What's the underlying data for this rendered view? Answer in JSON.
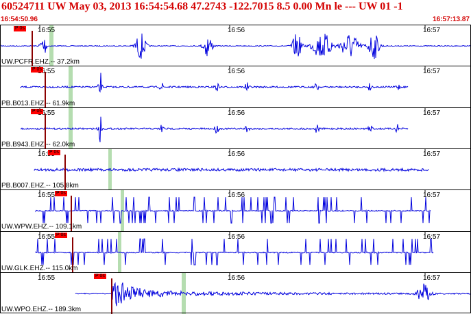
{
  "header": {
    "title": "60524711 UW May 03, 2013 16:54:54.68   47.2743 -122.7015  8.5 0.00 Mn le --- UW 01  -1",
    "start_time": "16:54:50.96",
    "end_time": "16:57:13.87"
  },
  "time_ticks": [
    "16:55",
    "16:56",
    "16:57"
  ],
  "colors": {
    "title": "#d40000",
    "trace": "#0000dd",
    "pick_flag": "#ff0000",
    "pick_line": "#8b0000",
    "window_band": "#b5ddb0",
    "grid": "#000000"
  },
  "traces": [
    {
      "station": "UW.PCFR.EHZ.-- 37.2km",
      "pick_label": "P 0s",
      "style": "bursts"
    },
    {
      "station": "PB.B013.EHZ.-- 61.9km",
      "pick_label": "P 0s",
      "style": "noise"
    },
    {
      "station": "PB.B943.EHZ.-- 62.0km",
      "pick_label": "P 0s",
      "style": "noise"
    },
    {
      "station": "PB.B007.EHZ.-- 105.8km",
      "pick_label": "P 0s",
      "style": "flat"
    },
    {
      "station": "UW.WPW.EHZ.-- 109.1km",
      "pick_label": "P 0s",
      "style": "spikes"
    },
    {
      "station": "UW.GLK.EHZ.-- 115.0km",
      "pick_label": "P 0s",
      "style": "spikes"
    },
    {
      "station": "UW.WPO.EHZ.-- 189.3km",
      "pick_label": "P 0s",
      "style": "quake"
    }
  ]
}
